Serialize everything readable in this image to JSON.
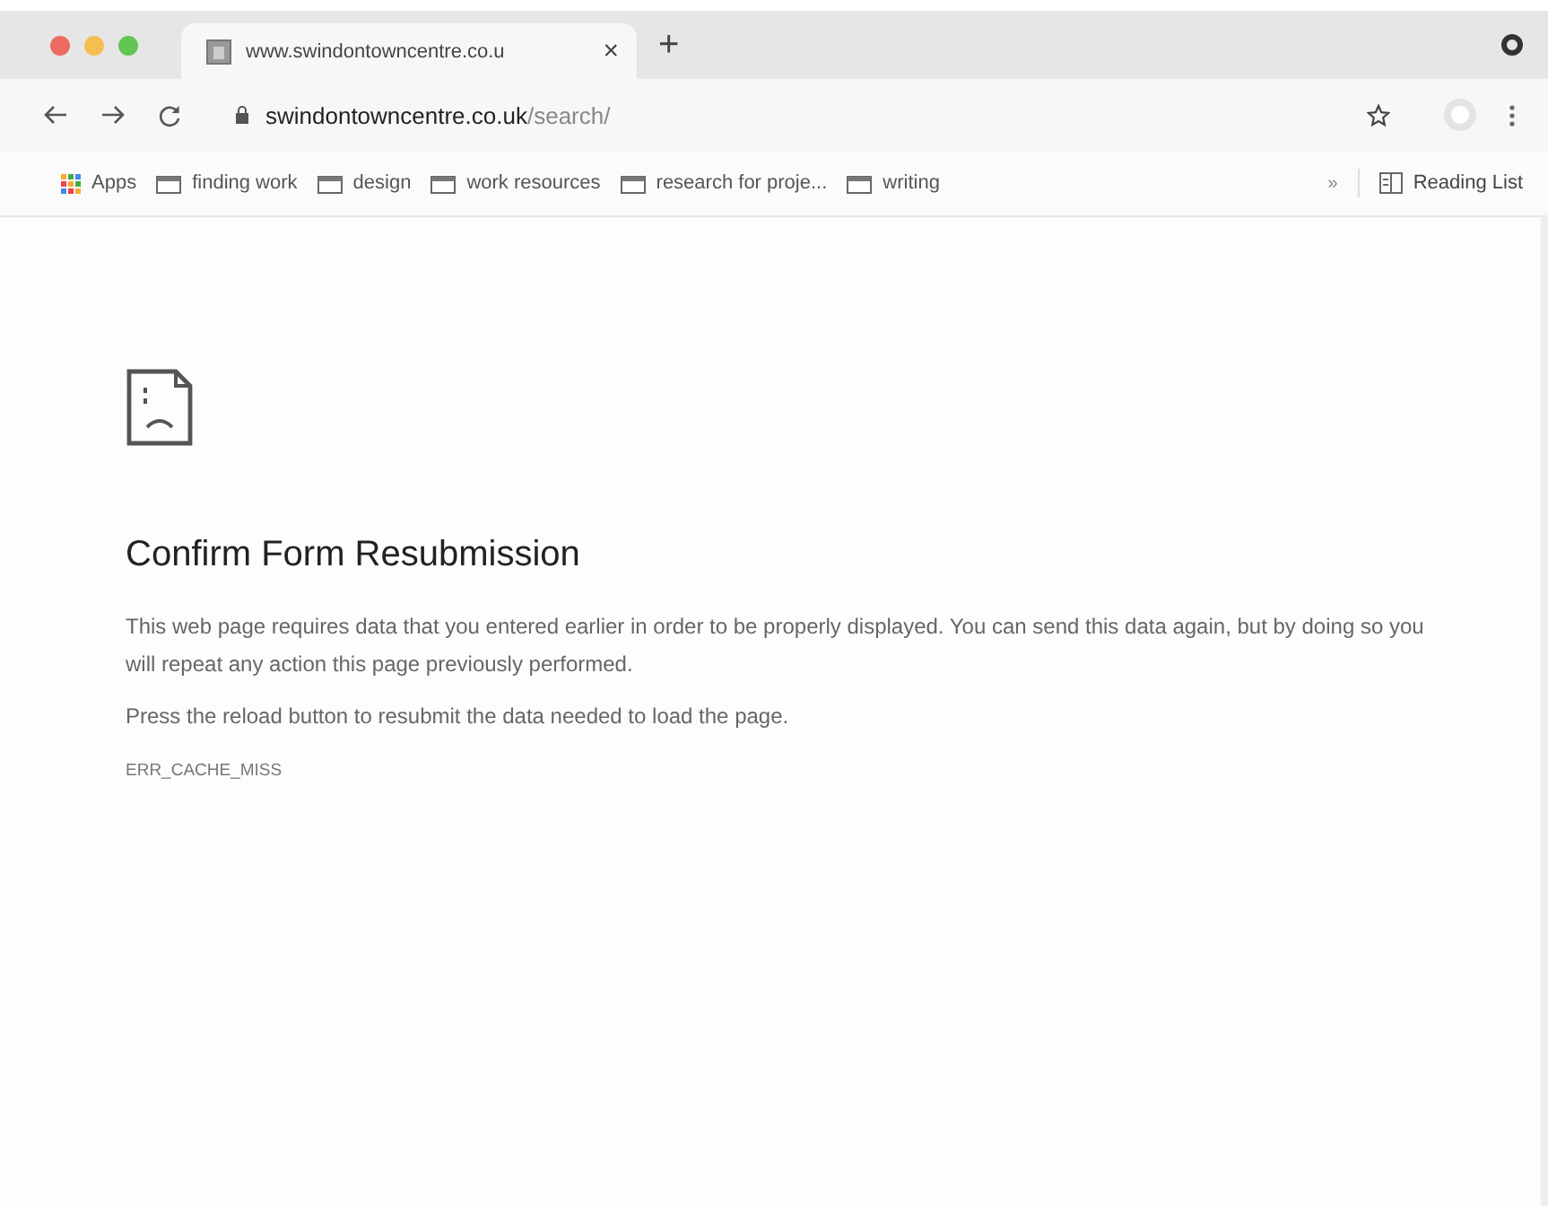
{
  "tab": {
    "title": "www.swindontowncentre.co.u",
    "close": "×",
    "new_tab": "+"
  },
  "url": {
    "host": "swindontowncentre.co.uk",
    "path": "/search/"
  },
  "bookmarks": [
    {
      "kind": "apps",
      "label": "Apps"
    },
    {
      "kind": "folder",
      "label": "finding work"
    },
    {
      "kind": "folder",
      "label": "design"
    },
    {
      "kind": "folder",
      "label": "work resources"
    },
    {
      "kind": "folder",
      "label": "research for proje..."
    },
    {
      "kind": "folder",
      "label": "writing"
    }
  ],
  "overflow": "»",
  "reading_list": "Reading List",
  "error": {
    "title": "Confirm Form Resubmission",
    "paragraphs": [
      "This web page requires data that you entered earlier in order to be properly displayed. You can send this data again, but by doing so you will repeat any action this page previously performed.",
      "Press the reload button to resubmit the data needed to load the page."
    ],
    "code": "ERR_CACHE_MISS"
  }
}
